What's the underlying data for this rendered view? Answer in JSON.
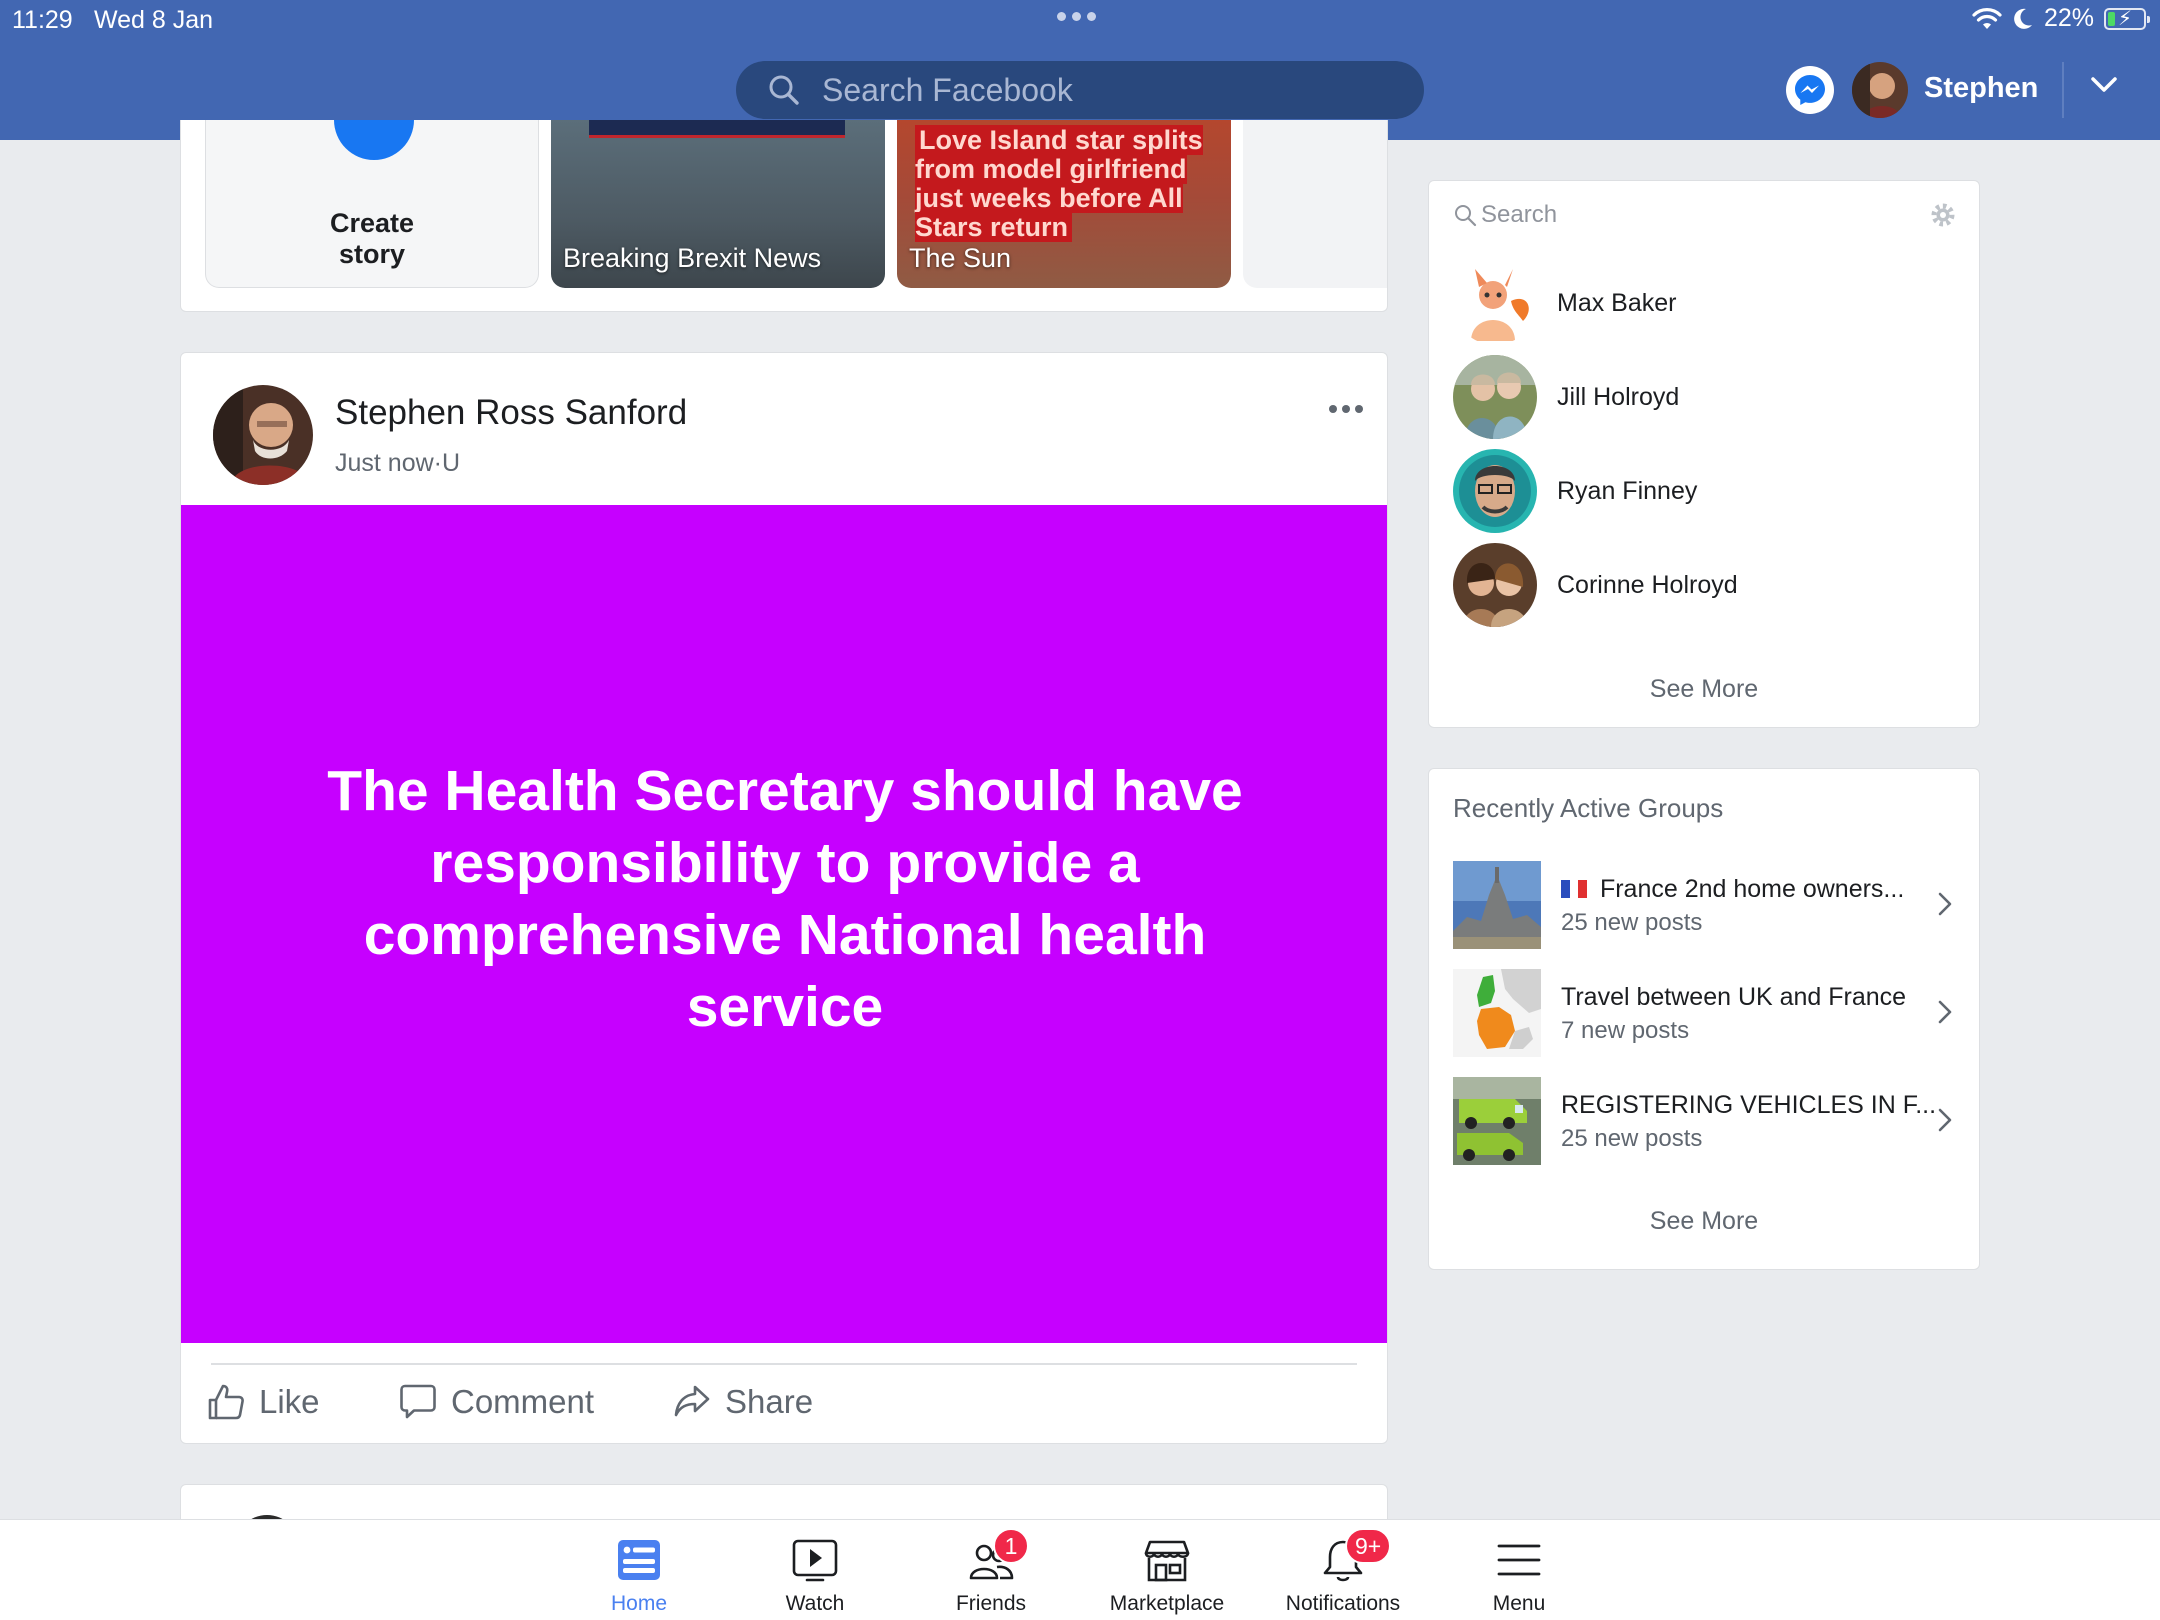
{
  "status_bar": {
    "time": "11:29",
    "date": "Wed 8 Jan",
    "battery": "22%",
    "battery_level": 0.22
  },
  "header": {
    "search_placeholder": "Search Facebook",
    "username": "Stephen"
  },
  "stories": {
    "create_label_line1": "Create",
    "create_label_line2": "story",
    "items": [
      {
        "name": "Breaking Brexit News"
      },
      {
        "name": "The Sun",
        "headline": "Love Island star splits from model girlfriend just weeks before All Stars return"
      }
    ]
  },
  "post": {
    "author": "Stephen Ross Sanford",
    "time": "Just now",
    "meta_sep": "·",
    "audience": "U",
    "text": "The Health Secretary should have responsibility to provide a comprehensive National health service",
    "background_color": "#c600ff",
    "actions": {
      "like": "Like",
      "comment": "Comment",
      "share": "Share"
    }
  },
  "contacts": {
    "search_placeholder": "Search",
    "items": [
      {
        "name": "Max Baker"
      },
      {
        "name": "Jill Holroyd"
      },
      {
        "name": "Ryan Finney"
      },
      {
        "name": "Corinne Holroyd"
      }
    ],
    "see_more": "See More"
  },
  "groups": {
    "title": "Recently Active Groups",
    "items": [
      {
        "flag": "🇫🇷",
        "name": "France 2nd home owners...",
        "posts": "25 new posts"
      },
      {
        "name": "Travel between UK and France",
        "posts": "7 new posts"
      },
      {
        "name": "REGISTERING VEHICLES IN F...",
        "posts": "25 new posts"
      }
    ],
    "see_more": "See More"
  },
  "tabs": [
    {
      "label": "Home",
      "icon": "home-feed-icon",
      "active": true
    },
    {
      "label": "Watch",
      "icon": "watch-play-icon"
    },
    {
      "label": "Friends",
      "icon": "friends-icon",
      "badge": "1"
    },
    {
      "label": "Marketplace",
      "icon": "marketplace-shop-icon"
    },
    {
      "label": "Notifications",
      "icon": "bell-icon",
      "badge": "9+"
    },
    {
      "label": "Menu",
      "icon": "hamburger-menu-icon"
    }
  ],
  "colors": {
    "brand": "#4267b2",
    "search_bg": "#29487d",
    "active_tab": "#4a80f0",
    "badge": "#f02849"
  }
}
